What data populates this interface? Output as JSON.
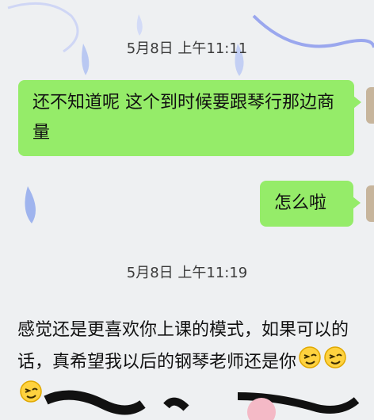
{
  "chat": {
    "messages": [
      {
        "type": "timestamp",
        "text": "5月8日 上午11:11"
      },
      {
        "type": "outgoing",
        "text": "还不知道呢 这个到时候要跟琴行那边商量"
      },
      {
        "type": "outgoing",
        "text": "怎么啦"
      },
      {
        "type": "timestamp",
        "text": "5月8日 上午11:19"
      },
      {
        "type": "incoming",
        "text": "感觉还是更喜欢你上课的模式，如果可以的话，真希望我以后的钢琴老师还是你",
        "emoji": [
          "wink-face-icon",
          "wink-face-icon",
          "wink-face-icon"
        ]
      }
    ]
  },
  "colors": {
    "outgoing_bubble": "#95ec69",
    "background": "#eef0f2",
    "text": "#111111"
  }
}
